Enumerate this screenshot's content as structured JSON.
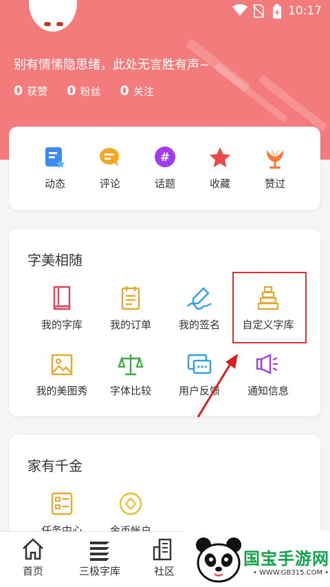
{
  "status_bar": {
    "time": "10:17"
  },
  "profile": {
    "signature": "别有情愫隐思绪，此处无言胜有声~",
    "stats": [
      {
        "count": "0",
        "label": "获赞"
      },
      {
        "count": "0",
        "label": "粉丝"
      },
      {
        "count": "0",
        "label": "关注"
      }
    ]
  },
  "quick_actions": [
    {
      "label": "动态",
      "icon": "activity-icon"
    },
    {
      "label": "评论",
      "icon": "comment-icon"
    },
    {
      "label": "话题",
      "icon": "topic-icon"
    },
    {
      "label": "收藏",
      "icon": "star-icon"
    },
    {
      "label": "赞过",
      "icon": "liked-icon"
    }
  ],
  "section_zimei": {
    "title": "字美相随",
    "items": [
      {
        "label": "我的字库",
        "icon": "font-library-icon"
      },
      {
        "label": "我的订单",
        "icon": "order-icon"
      },
      {
        "label": "我的签名",
        "icon": "signature-icon"
      },
      {
        "label": "自定义字库",
        "icon": "custom-font-icon"
      },
      {
        "label": "我的美图秀",
        "icon": "image-icon"
      },
      {
        "label": "字体比较",
        "icon": "compare-icon"
      },
      {
        "label": "用户反馈",
        "icon": "feedback-icon"
      },
      {
        "label": "通知信息",
        "icon": "notification-icon"
      }
    ]
  },
  "section_family": {
    "title": "家有千金",
    "items": [
      {
        "label": "任务中心",
        "icon": "task-icon"
      },
      {
        "label": "金币帐户",
        "icon": "coin-icon"
      }
    ]
  },
  "tabbar": [
    {
      "label": "首页",
      "icon": "home-icon"
    },
    {
      "label": "三极字库",
      "icon": "library-icon"
    },
    {
      "label": "社区",
      "icon": "community-icon"
    }
  ],
  "watermark": {
    "brand": "国宝手游网",
    "url": "• WWW.GB315.COM •"
  },
  "colors": {
    "header": "#f47b7b",
    "highlight": "#e03030",
    "accent_red": "#e84a4a"
  }
}
